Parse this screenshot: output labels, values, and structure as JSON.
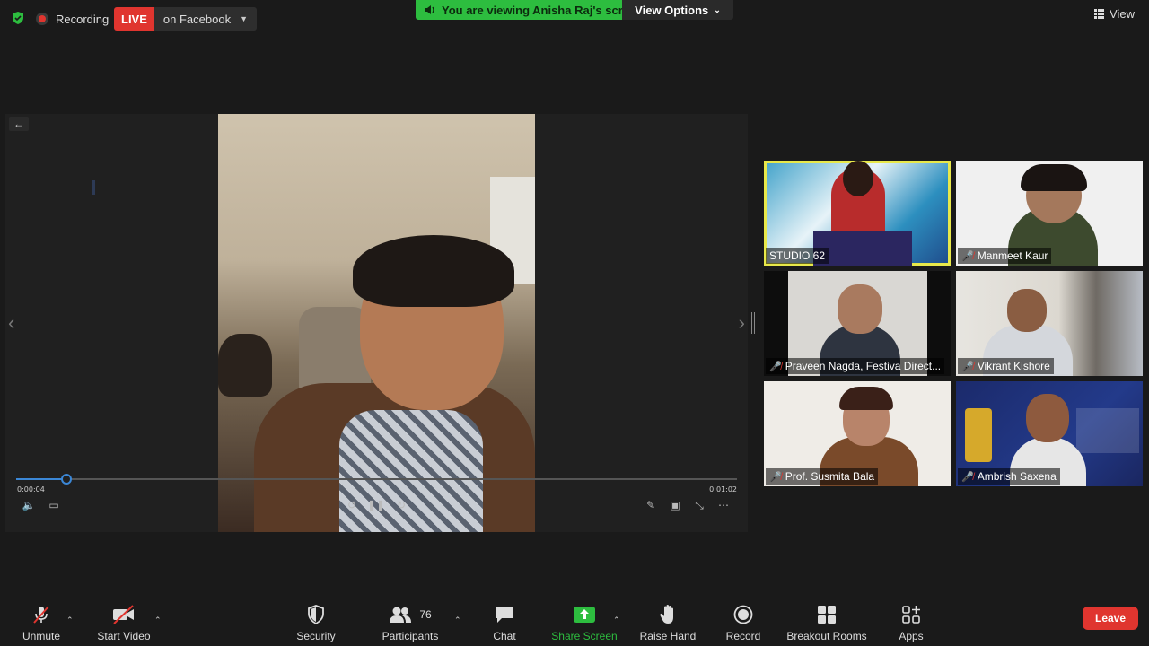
{
  "top_bar": {
    "recording_label": "Recording",
    "live_badge": "LIVE",
    "live_target": "on Facebook",
    "viewing_text": "You are viewing Anisha Raj's screen",
    "view_options_label": "View Options",
    "view_label": "View"
  },
  "share": {
    "time_current": "0:00:04",
    "time_total": "0:01:02",
    "progress_fraction": 0.07
  },
  "participants": [
    {
      "name": "STUDIO 62",
      "muted": false,
      "active": true
    },
    {
      "name": "Manmeet Kaur",
      "muted": true,
      "active": false
    },
    {
      "name": "Praveen Nagda, Festiva  Direct...",
      "muted": true,
      "active": false
    },
    {
      "name": "Vikrant Kishore",
      "muted": true,
      "active": false
    },
    {
      "name": "Prof. Susmita Bala",
      "muted": true,
      "active": false
    },
    {
      "name": "Ambrish Saxena",
      "muted": true,
      "active": false
    }
  ],
  "toolbar": {
    "unmute": "Unmute",
    "start_video": "Start Video",
    "security": "Security",
    "participants": "Participants",
    "participants_count": "76",
    "chat": "Chat",
    "share_screen": "Share Screen",
    "raise_hand": "Raise Hand",
    "record": "Record",
    "breakout_rooms": "Breakout Rooms",
    "apps": "Apps",
    "leave": "Leave"
  },
  "colors": {
    "accent_green": "#2dbd3f",
    "live_red": "#e0352f",
    "active_speaker_outline": "#e8e84a",
    "progress_blue": "#3b87d6"
  },
  "icons": {
    "security_shield": "shield-icon",
    "record_dot": "record-dot-icon",
    "view_grid": "grid-icon"
  }
}
